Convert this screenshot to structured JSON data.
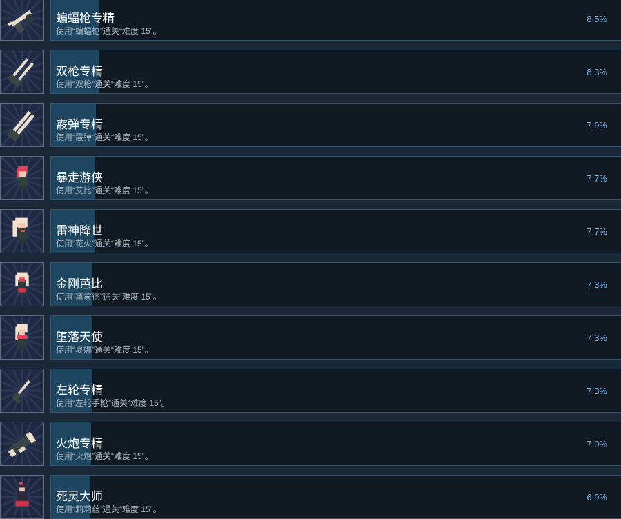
{
  "achievements": [
    {
      "title": "蝙蝠枪专精",
      "description": "使用“蝙蝠枪”通关“难度 15”。",
      "percent_label": "8.5%",
      "percent": 8.5,
      "icon": "bat-gun-icon"
    },
    {
      "title": "双枪专精",
      "description": "使用“双枪”通关“难度 15”。",
      "percent_label": "8.3%",
      "percent": 8.3,
      "icon": "dual-guns-icon"
    },
    {
      "title": "霰弹专精",
      "description": "使用“霰弹”通关“难度 15”。",
      "percent_label": "7.9%",
      "percent": 7.9,
      "icon": "shotgun-icon"
    },
    {
      "title": "暴走游侠",
      "description": "使用“艾比”通关“难度 15”。",
      "percent_label": "7.7%",
      "percent": 7.7,
      "icon": "abby-character-icon"
    },
    {
      "title": "雷神降世",
      "description": "使用“花火”通关“难度 15”。",
      "percent_label": "7.7%",
      "percent": 7.7,
      "icon": "hanabi-character-icon"
    },
    {
      "title": "金刚芭比",
      "description": "使用“黛蒙德”通关“难度 15”。",
      "percent_label": "7.3%",
      "percent": 7.3,
      "icon": "diamond-character-icon"
    },
    {
      "title": "堕落天使",
      "description": "使用“夏娜”通关“难度 15”。",
      "percent_label": "7.3%",
      "percent": 7.3,
      "icon": "shana-character-icon"
    },
    {
      "title": "左轮专精",
      "description": "使用“左轮手枪”通关“难度 15”。",
      "percent_label": "7.3%",
      "percent": 7.3,
      "icon": "revolver-icon"
    },
    {
      "title": "火炮专精",
      "description": "使用“火炮”通关“难度 15”。",
      "percent_label": "7.0%",
      "percent": 7.0,
      "icon": "cannon-icon"
    },
    {
      "title": "死灵大师",
      "description": "使用“莉莉丝”通关“难度 15”。",
      "percent_label": "6.9%",
      "percent": 6.9,
      "icon": "lilith-character-icon"
    }
  ],
  "colors": {
    "background": "#1b2838",
    "card": "#111923",
    "progress_fill": "#1e4660",
    "percent_text": "#7fb6e6",
    "icon_background": "#1f2942"
  }
}
